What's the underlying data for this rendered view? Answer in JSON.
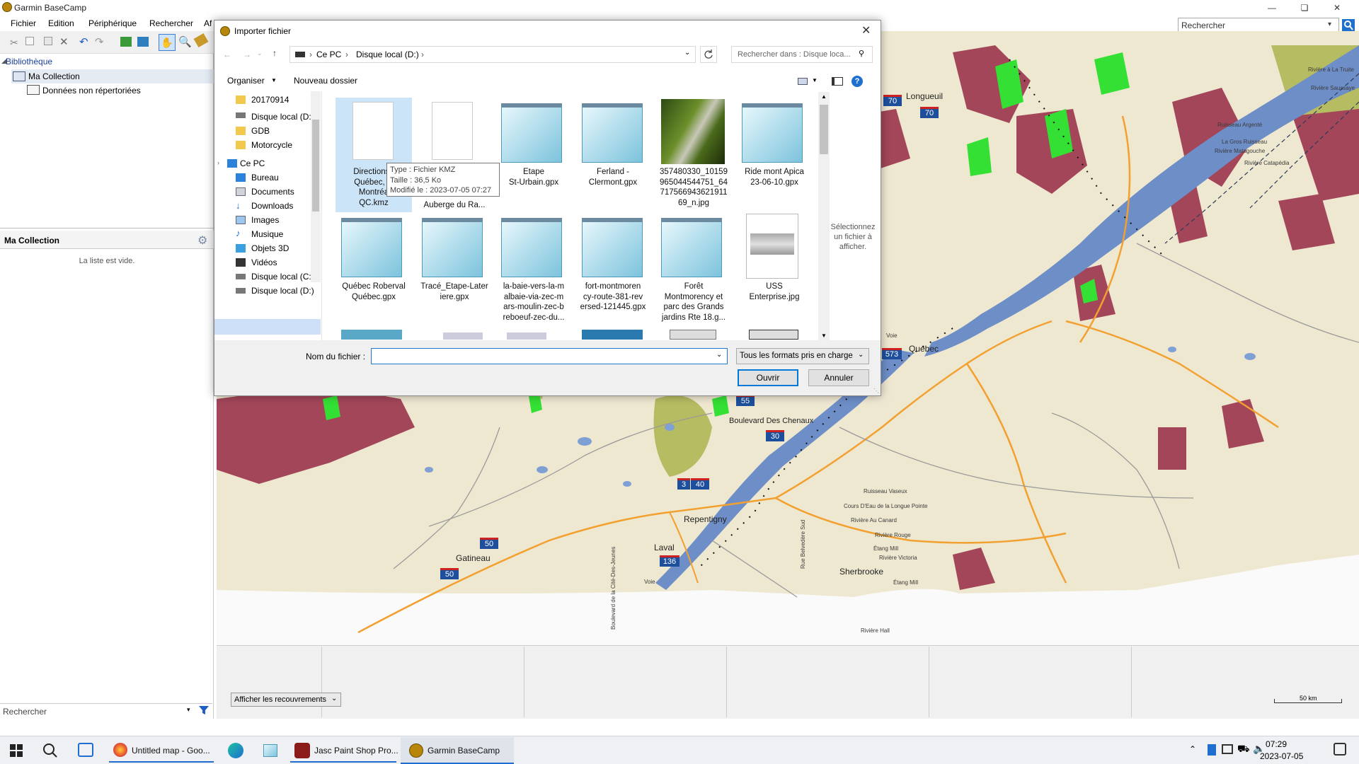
{
  "app": {
    "title": "Garmin BaseCamp"
  },
  "menu": {
    "items": [
      "Fichier",
      "Edition",
      "Périphérique",
      "Rechercher",
      "Af"
    ]
  },
  "top_search": {
    "placeholder": "Rechercher"
  },
  "library": {
    "header": "Bibliothèque",
    "collection": "Ma Collection",
    "uncategorized": "Données non répertoriées"
  },
  "my_collection": {
    "title": "Ma Collection",
    "empty": "La liste est vide."
  },
  "left_search": {
    "placeholder": "Rechercher"
  },
  "dialog": {
    "title": "Importer fichier",
    "breadcrumb": [
      "Ce PC",
      "Disque local (D:)"
    ],
    "search_placeholder": "Rechercher dans : Disque loca...",
    "organize": "Organiser",
    "new_folder": "Nouveau dossier",
    "nav_items": [
      "20170914",
      "Disque local (D:)",
      "GDB",
      "Motorcycle",
      "Ce PC",
      "Bureau",
      "Documents",
      "Downloads",
      "Images",
      "Musique",
      "Objets 3D",
      "Vidéos",
      "Disque local (C:)",
      "Disque local (D:)"
    ],
    "files": [
      {
        "name": "Directions f\nQuébec, Q\nMontréa\nQC.kmz",
        "kind": "blank"
      },
      {
        "name": "\nAuberge du Ra...",
        "kind": "blank"
      },
      {
        "name": "Etape\nSt-Urbain.gpx",
        "kind": "notepad"
      },
      {
        "name": "Ferland -\nClermont.gpx",
        "kind": "notepad"
      },
      {
        "name": "357480330_10159\n965044544751_64\n717566943621911\n69_n.jpg",
        "kind": "photo"
      },
      {
        "name": "Ride mont Apica\n23-06-10.gpx",
        "kind": "notepad"
      },
      {
        "name": "Québec Roberval\nQuébec.gpx",
        "kind": "notepad"
      },
      {
        "name": "Tracé_Etape-Later\niere.gpx",
        "kind": "notepad"
      },
      {
        "name": "la-baie-vers-la-m\nalbaie-via-zec-m\nars-moulin-zec-b\nreboeuf-zec-du...",
        "kind": "notepad"
      },
      {
        "name": "fort-montmoren\ncy-route-381-rev\nersed-121445.gpx",
        "kind": "notepad"
      },
      {
        "name": "Forêt\nMontmorency et\nparc des Grands\njardins Rte 18.g...",
        "kind": "notepad"
      },
      {
        "name": "USS\nEnterprise.jpg",
        "kind": "doc"
      }
    ],
    "tooltip": [
      "Type : Fichier KMZ",
      "Taille : 36,5 Ko",
      "Modifié le : 2023-07-05 07:27"
    ],
    "preview": "Sélectionnez un fichier à afficher.",
    "filename_label": "Nom du fichier :",
    "filename_value": "",
    "filetype": "Tous les formats pris en charge",
    "open": "Ouvrir",
    "cancel": "Annuler"
  },
  "map": {
    "labels": [
      {
        "text": "Longueuil",
        "kind": "city"
      },
      {
        "text": "Québec",
        "kind": "city"
      },
      {
        "text": "Boulevard Des Chenaux",
        "kind": "road"
      },
      {
        "text": "Repentigny",
        "kind": "city"
      },
      {
        "text": "Laval",
        "kind": "city"
      },
      {
        "text": "Gatineau",
        "kind": "city"
      },
      {
        "text": "Sherbrooke",
        "kind": "city"
      },
      {
        "text": "Rivière à La Truite",
        "kind": "small"
      },
      {
        "text": "Rivière Saussaye",
        "kind": "small"
      },
      {
        "text": "Ruisseau Argenté",
        "kind": "small"
      },
      {
        "text": "La Gros Ruisseau",
        "kind": "small"
      },
      {
        "text": "Rivière Matagouche",
        "kind": "small"
      },
      {
        "text": "Rivière Catapédia",
        "kind": "small"
      },
      {
        "text": "Ruisseau Vaseux",
        "kind": "small"
      },
      {
        "text": "Cours D'Eau de la Longue Pointe",
        "kind": "small"
      },
      {
        "text": "Rivière Au Canard",
        "kind": "small"
      },
      {
        "text": "Rivière Rouge",
        "kind": "small"
      },
      {
        "text": "Étang Mill",
        "kind": "small"
      },
      {
        "text": "Rivière Victoria",
        "kind": "small"
      },
      {
        "text": "Rivière Hall",
        "kind": "small"
      },
      {
        "text": "Étang Mill",
        "kind": "small"
      },
      {
        "text": "Rue Belvedère Sud",
        "kind": "small"
      },
      {
        "text": "Boulevard de la Cité-Des-Jeunes",
        "kind": "small"
      },
      {
        "text": "Voie",
        "kind": "small"
      },
      {
        "text": "Voie",
        "kind": "small"
      }
    ],
    "shields": [
      "70",
      "70",
      "573",
      "55",
      "30",
      "3",
      "40",
      "50",
      "50",
      "136"
    ],
    "overlap_select": "Afficher les recouvrements",
    "scale": "50 km"
  },
  "taskbar": {
    "apps": [
      "Untitled map - Goo...",
      "Jasc Paint Shop Pro...",
      "Garmin BaseCamp"
    ],
    "time": "07:29",
    "date": "2023-07-05"
  }
}
